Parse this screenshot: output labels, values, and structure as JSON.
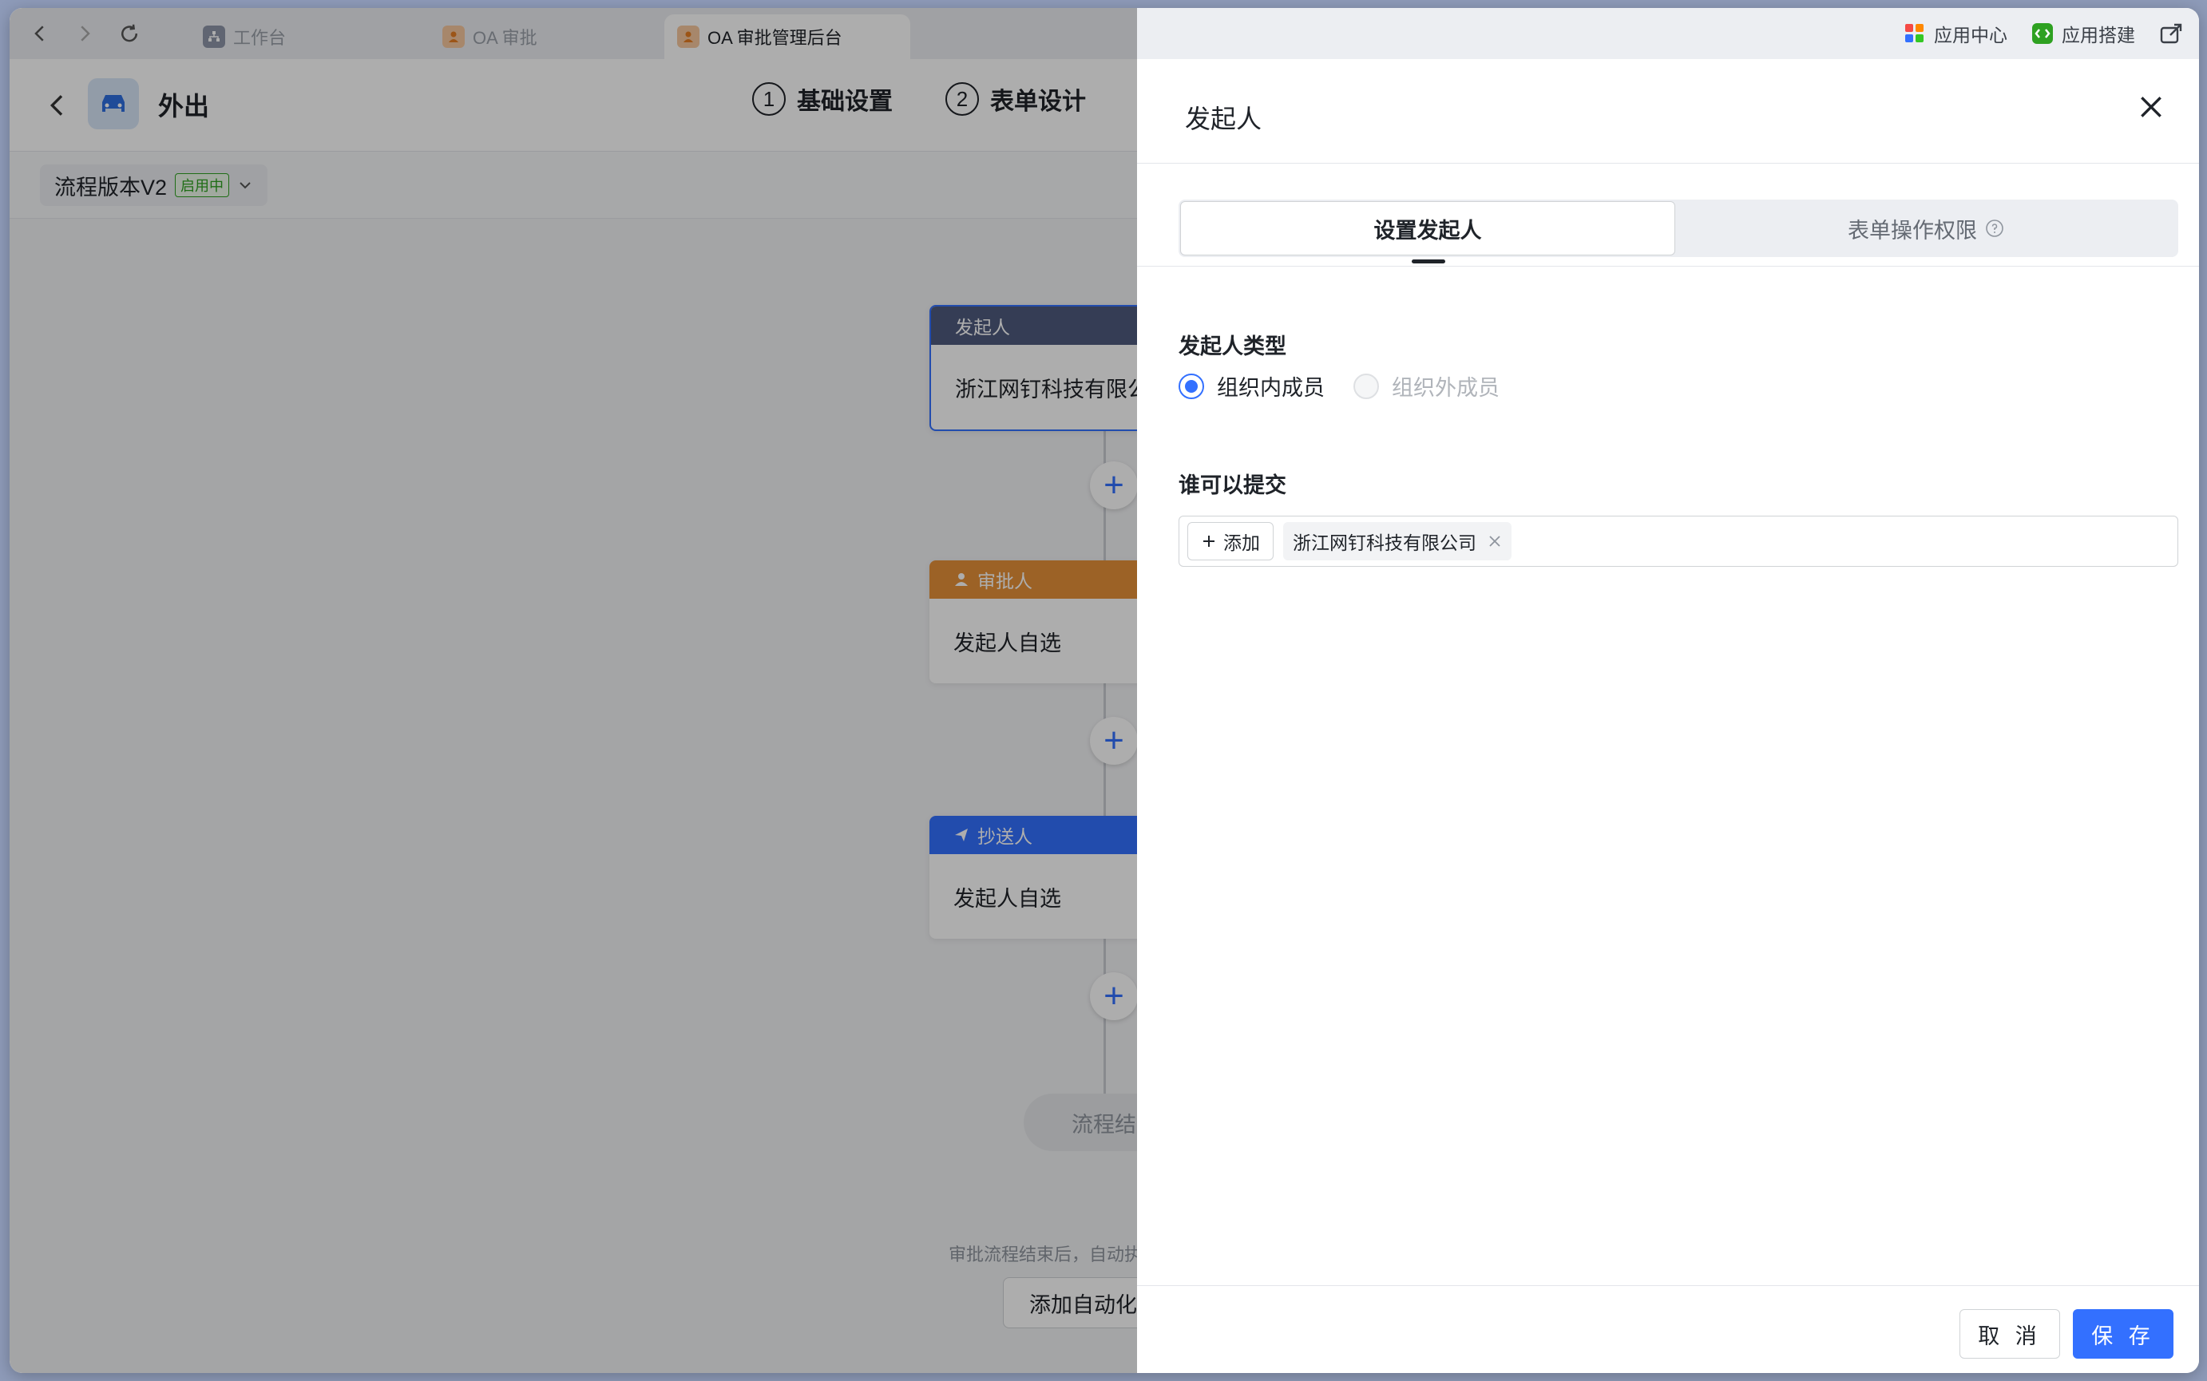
{
  "browser": {
    "tabs": [
      {
        "label": "工作台"
      },
      {
        "label": "OA 审批"
      },
      {
        "label": "OA 审批管理后台"
      }
    ],
    "right_items": [
      {
        "label": "应用中心"
      },
      {
        "label": "应用搭建"
      }
    ]
  },
  "editor": {
    "title": "外出",
    "steps": [
      {
        "num": "1",
        "label": "基础设置"
      },
      {
        "num": "2",
        "label": "表单设计"
      }
    ],
    "version": {
      "label": "流程版本V2",
      "badge": "启用中"
    },
    "nodes": [
      {
        "header": "发起人",
        "body": "浙江网钉科技有限公司",
        "color": "#4e5a7e"
      },
      {
        "header": "审批人",
        "body": "发起人自选",
        "color": "#e69138"
      },
      {
        "header": "抄送人",
        "body": "发起人自选",
        "color": "#3370ff"
      }
    ],
    "end_label": "流程结束",
    "footer_note": "审批流程结束后，自动执行",
    "auto_button": "添加自动化"
  },
  "drawer": {
    "title": "发起人",
    "tabs": {
      "active": "设置发起人",
      "inactive": "表单操作权限"
    },
    "initiator_type_label": "发起人类型",
    "options": {
      "inside": "组织内成员",
      "outside": "组织外成员"
    },
    "submit_label": "谁可以提交",
    "add_label": "添加",
    "selected_org": "浙江网钉科技有限公司",
    "cancel_label": "取 消",
    "save_label": "保 存"
  },
  "colors": {
    "accent": "#3370ff",
    "success": "#2ea121"
  }
}
